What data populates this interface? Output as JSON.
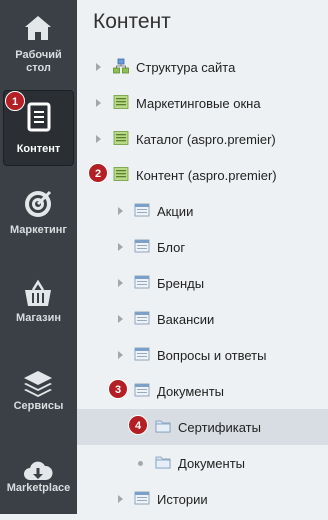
{
  "sidebar": {
    "items": [
      {
        "label_line1": "Рабочий",
        "label_line2": "стол",
        "icon": "home-icon"
      },
      {
        "label": "Контент",
        "icon": "document-icon",
        "active": true,
        "badge": "1"
      },
      {
        "label": "Маркетинг",
        "icon": "target-icon"
      },
      {
        "label": "Магазин",
        "icon": "basket-icon"
      },
      {
        "label": "Сервисы",
        "icon": "layers-icon"
      },
      {
        "label": "Marketplace",
        "icon": "cloud-download-icon"
      }
    ]
  },
  "panel": {
    "title": "Контент",
    "tree": [
      {
        "label": "Структура сайта",
        "icon": "site-structure-icon"
      },
      {
        "label": "Маркетинговые окна",
        "icon": "module-icon"
      },
      {
        "label": "Каталог (aspro.premier)",
        "icon": "module-icon"
      },
      {
        "label": "Контент (aspro.premier)",
        "icon": "module-icon",
        "badge": "2"
      },
      {
        "label": "Акции",
        "icon": "iblock-icon"
      },
      {
        "label": "Блог",
        "icon": "iblock-icon"
      },
      {
        "label": "Бренды",
        "icon": "iblock-icon"
      },
      {
        "label": "Вакансии",
        "icon": "iblock-icon"
      },
      {
        "label": "Вопросы и ответы",
        "icon": "iblock-icon"
      },
      {
        "label": "Документы",
        "icon": "iblock-icon",
        "badge": "3"
      },
      {
        "label": "Сертификаты",
        "icon": "folder-icon",
        "badge": "4",
        "selected": true
      },
      {
        "label": "Документы",
        "icon": "folder-icon"
      },
      {
        "label": "Истории",
        "icon": "iblock-icon"
      }
    ]
  }
}
